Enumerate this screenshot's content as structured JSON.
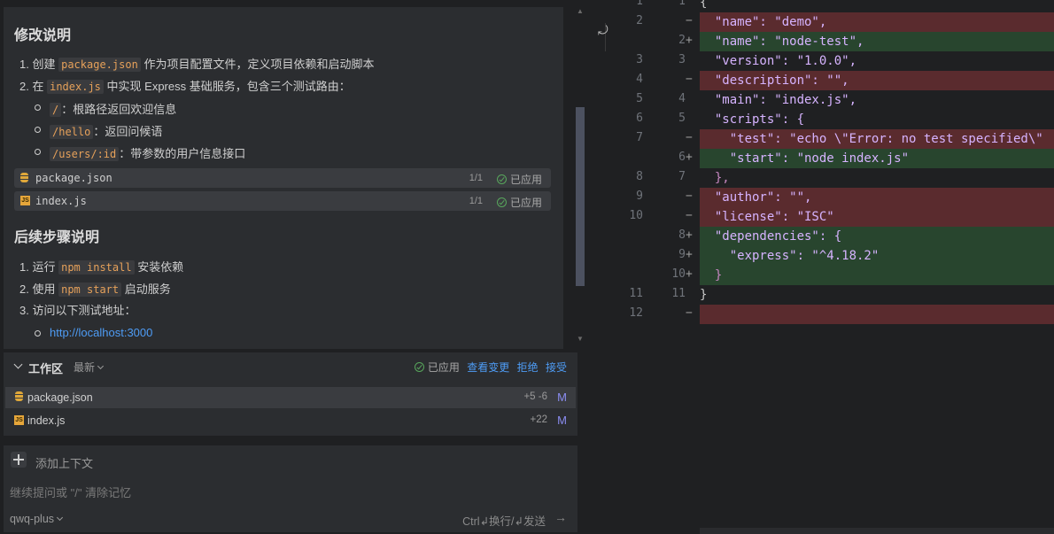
{
  "chat": {
    "section1_title": "修改说明",
    "steps": [
      {
        "n": "1.",
        "pre": "创建",
        "code": "package.json",
        "post": "作为项目配置文件，定义项目依赖和启动脚本"
      },
      {
        "n": "2.",
        "pre": "在",
        "code": "index.js",
        "post": "中实现 Express 基础服务，包含三个测试路由："
      }
    ],
    "routes": [
      {
        "code": "/",
        "desc": "：根路径返回欢迎信息"
      },
      {
        "code": "/hello",
        "desc": "：返回问候语"
      },
      {
        "code": "/users/:id",
        "desc": "：带参数的用户信息接口"
      }
    ],
    "files": [
      {
        "name": "package.json",
        "count": "1/1",
        "status": "已应用"
      },
      {
        "name": "index.js",
        "count": "1/1",
        "status": "已应用"
      }
    ],
    "section2_title": "后续步骤说明",
    "next_steps": [
      {
        "n": "1.",
        "pre": "运行",
        "code": "npm install",
        "post": "安装依赖"
      },
      {
        "n": "2.",
        "pre": "使用",
        "code": "npm start",
        "post": "启动服务"
      },
      {
        "n": "3.",
        "pre": "访问以下测试地址：",
        "code": "",
        "post": ""
      }
    ],
    "url": "http://localhost:3000"
  },
  "workspace": {
    "title": "工作区",
    "recent": "最新",
    "applied": "已应用",
    "view_changes": "查看变更",
    "reject": "拒绝",
    "accept": "接受",
    "files": [
      {
        "name": "package.json",
        "diff": "+5 -6",
        "status": "M",
        "icon": "database-icon"
      },
      {
        "name": "index.js",
        "diff": "+22",
        "status": "M",
        "icon": "js-file-icon"
      }
    ]
  },
  "input": {
    "add_context": "添加上下文",
    "placeholder": "继续提问或 \"/\" 清除记忆",
    "model": "qwq-plus",
    "hint": "Ctrl↲换行/↲发送"
  },
  "editor": {
    "lines": [
      {
        "old": "1",
        "new": "1",
        "mark": "",
        "type": "ctx",
        "code": "{"
      },
      {
        "old": "2",
        "new": "",
        "mark": "−",
        "type": "del",
        "code": "  \"name\": \"demo\","
      },
      {
        "old": "",
        "new": "2",
        "mark": "+",
        "type": "add",
        "code": "  \"name\": \"node-test\","
      },
      {
        "old": "3",
        "new": "3",
        "mark": "",
        "type": "ctx",
        "code": "  \"version\": \"1.0.0\","
      },
      {
        "old": "4",
        "new": "",
        "mark": "−",
        "type": "del",
        "code": "  \"description\": \"\","
      },
      {
        "old": "5",
        "new": "4",
        "mark": "",
        "type": "ctx",
        "code": "  \"main\": \"index.js\","
      },
      {
        "old": "6",
        "new": "5",
        "mark": "",
        "type": "ctx",
        "code": "  \"scripts\": {"
      },
      {
        "old": "7",
        "new": "",
        "mark": "−",
        "type": "del",
        "code": "    \"test\": \"echo \\\"Error: no test specified\\\""
      },
      {
        "old": "",
        "new": "6",
        "mark": "+",
        "type": "add",
        "code": "    \"start\": \"node index.js\""
      },
      {
        "old": "8",
        "new": "7",
        "mark": "",
        "type": "ctx",
        "code": "  },"
      },
      {
        "old": "9",
        "new": "",
        "mark": "−",
        "type": "del",
        "code": "  \"author\": \"\","
      },
      {
        "old": "10",
        "new": "",
        "mark": "−",
        "type": "del",
        "code": "  \"license\": \"ISC\""
      },
      {
        "old": "",
        "new": "8",
        "mark": "+",
        "type": "add",
        "code": "  \"dependencies\": {"
      },
      {
        "old": "",
        "new": "9",
        "mark": "+",
        "type": "add",
        "code": "    \"express\": \"^4.18.2\""
      },
      {
        "old": "",
        "new": "10",
        "mark": "+",
        "type": "add",
        "code": "  }"
      },
      {
        "old": "11",
        "new": "11",
        "mark": "",
        "type": "ctx",
        "code": "}"
      },
      {
        "old": "12",
        "new": "",
        "mark": "−",
        "type": "del",
        "code": ""
      }
    ]
  }
}
